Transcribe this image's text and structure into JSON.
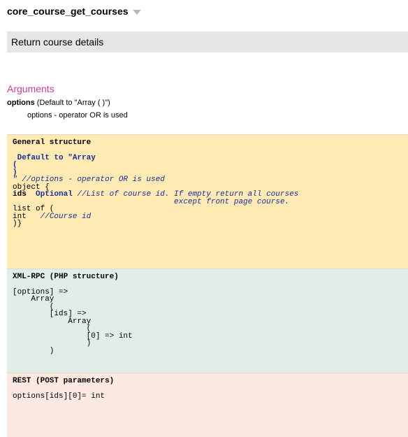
{
  "function_name": "core_course_get_courses",
  "description": "Return course details",
  "arguments": {
    "heading": "Arguments",
    "param_name": "options",
    "param_default": " (Default to \"Array ( )\")",
    "param_desc": "options - operator OR is used"
  },
  "general": {
    "title": "General structure",
    "default_to": " Default to \"Array",
    "open_paren": "(",
    "close_paren": ")",
    "quote_comment": "\" //options - operator OR is used",
    "object_open": "object {",
    "ids_keyword": "ids",
    "ids_optional": "  Optional",
    "ids_comment": " //List of course id. If empty return all courses",
    "ids_comment_cont": "                                   except front page course.",
    "list_of": "list of (",
    "int_kw": "int",
    "int_comment": "   //Course id",
    "close": ")}"
  },
  "xmlrpc": {
    "title": "XML-RPC (PHP structure)",
    "lines": [
      "[options] =>",
      "    Array",
      "        (",
      "        [ids] =>",
      "            Array",
      "                (",
      "                [0] => int",
      "                )",
      "        )"
    ]
  },
  "rest": {
    "title": "REST (POST parameters)",
    "line": "options[ids][0]= int"
  }
}
